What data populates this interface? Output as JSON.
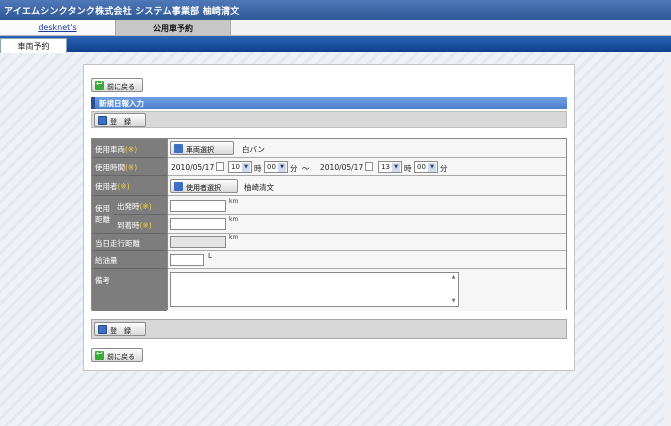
{
  "header": {
    "title": "アイエムシンクタンク株式会社 システム事業部 柚崎清文"
  },
  "tabs": {
    "desknets": "desknet's",
    "car_booking": "公用車予約"
  },
  "subtab": {
    "label": "車両予約"
  },
  "buttons": {
    "back": "前に戻る",
    "register": "登　録",
    "vehicle_select": "車両選択",
    "user_select": "使用者選択"
  },
  "section": {
    "title": "新規日報入力"
  },
  "form": {
    "vehicle_label": "使用車両",
    "vehicle_value": "白バン",
    "time_label": "使用時間",
    "start_date": "2010/05/17",
    "start_hour": "10",
    "start_min": "00",
    "end_date": "2010/05/17",
    "end_hour": "13",
    "end_min": "00",
    "hour_unit": "時",
    "min_unit": "分",
    "range_sep": "～",
    "user_label": "使用者",
    "user_value": "柚崎清文",
    "distance_label_1": "使用",
    "distance_label_2": "距離",
    "depart_label": "出発時",
    "arrive_label": "到着時",
    "today_label": "当日走行距離",
    "fuel_label": "給油量",
    "fuel_unit": "L",
    "km": "km",
    "remarks_label": "備考",
    "required_mark": "(※)"
  }
}
